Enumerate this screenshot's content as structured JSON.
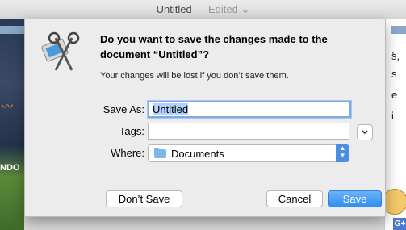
{
  "window": {
    "title": "Untitled",
    "edited": "— Edited"
  },
  "dialog": {
    "heading": "Do you want to save the changes made to the document “Untitled”?",
    "subtext": "Your changes will be lost if you don’t save them.",
    "save_as_label": "Save As:",
    "save_as_value": "Untitled",
    "tags_label": "Tags:",
    "tags_value": "",
    "where_label": "Where:",
    "where_value": "Documents",
    "dont_save_label": "Don’t Save",
    "cancel_label": "Cancel",
    "save_label": "Save"
  },
  "background": {
    "left_text": "NDO",
    "right_lines": [
      ",",
      "s,",
      "s",
      "e",
      "i"
    ]
  },
  "icons": {
    "app": "scissors-app-icon",
    "expand": "chevron-down-icon",
    "folder": "folder-icon",
    "popup": "updown-stepper-icon"
  },
  "colors": {
    "accent": "#2f8ef5",
    "selection": "#b3d2ff",
    "sheet_bg": "#ececec"
  }
}
